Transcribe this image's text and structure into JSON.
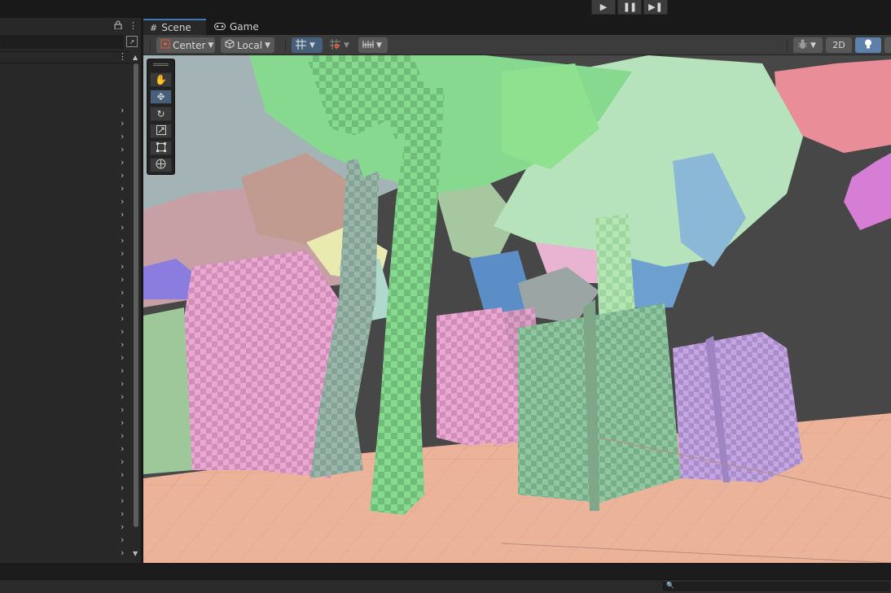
{
  "playbar": {
    "play_icon": "play-icon",
    "pause_icon": "pause-icon",
    "step_icon": "step-icon"
  },
  "hierarchy": {
    "lock_icon": "lock-icon",
    "menu_icon": "kebab-menu-icon",
    "rows": 35
  },
  "tabs": [
    {
      "label": "Scene",
      "icon": "grid-hash-icon"
    },
    {
      "label": "Game",
      "icon": "gamepad-icon"
    }
  ],
  "toolbar": {
    "pivot_label": "Center",
    "space_label": "Local",
    "view_2d_label": "2D"
  },
  "colors": {
    "accent": "#3a79bb",
    "active_button": "#46607c",
    "ground": "#eab49a",
    "tree_green": "#7fd48a",
    "pink_foliage": "#e9a3cf",
    "purple_foliage": "#b594d6",
    "red_foliage": "#e98e98"
  }
}
